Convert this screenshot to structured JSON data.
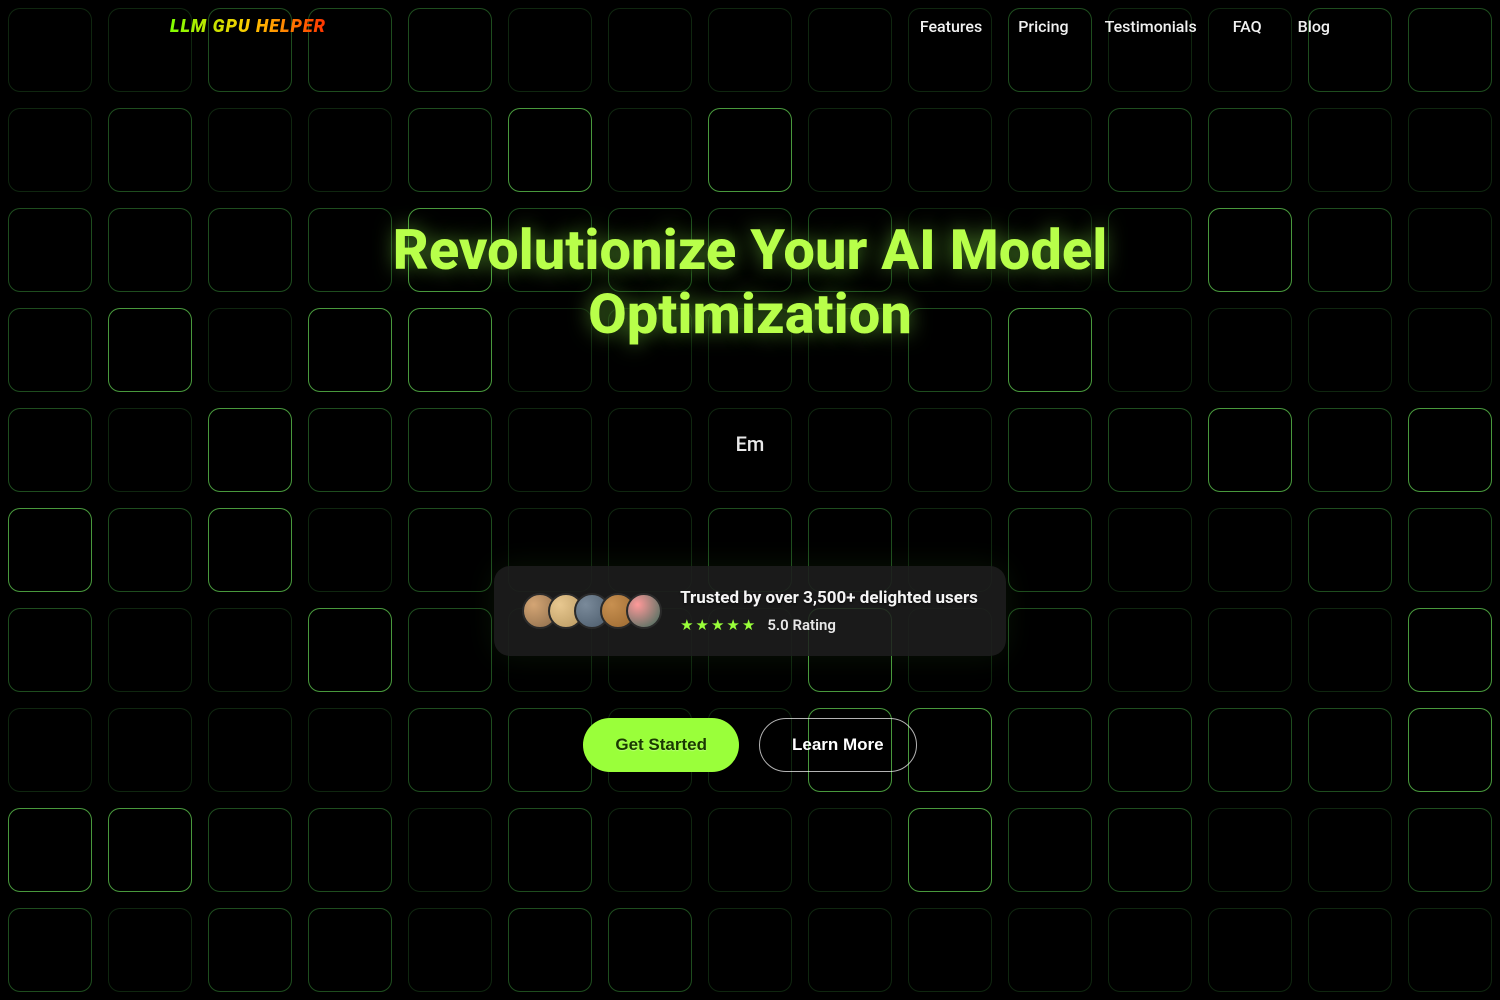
{
  "brand": "LLM GPU HELPER",
  "nav": {
    "features": "Features",
    "pricing": "Pricing",
    "testimonials": "Testimonials",
    "faq": "FAQ",
    "blog": "Blog"
  },
  "hero": {
    "title": "Revolutionize Your AI Model Optimization",
    "typing_text": "Em"
  },
  "trust": {
    "headline": "Trusted by over 3,500+ delighted users",
    "stars": "★★★★★",
    "rating": "5.0 Rating"
  },
  "cta": {
    "primary": "Get Started",
    "secondary": "Learn More"
  },
  "colors": {
    "accent": "#9aff3a",
    "title_glow": "#b8ff4a"
  }
}
